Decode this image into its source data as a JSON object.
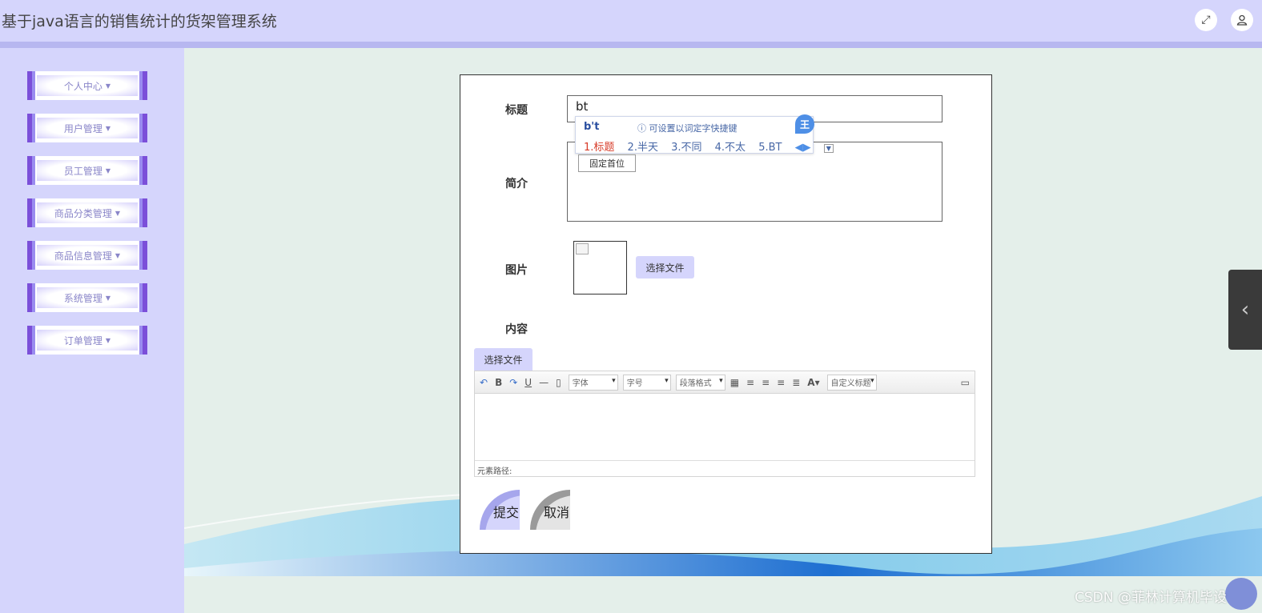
{
  "header": {
    "title": "基于java语言的销售统计的货架管理系统",
    "fullscreen_icon": "expand-icon",
    "user_icon": "user-icon"
  },
  "sidebar": {
    "items": [
      {
        "label": "个人中心"
      },
      {
        "label": "用户管理"
      },
      {
        "label": "员工管理"
      },
      {
        "label": "商品分类管理"
      },
      {
        "label": "商品信息管理"
      },
      {
        "label": "系统管理"
      },
      {
        "label": "订单管理"
      }
    ]
  },
  "form": {
    "title_label": "标题",
    "title_value": "bt",
    "intro_label": "简介",
    "image_label": "图片",
    "image_button": "选择文件",
    "content_label": "内容",
    "content_file_button": "选择文件",
    "submit": "提交",
    "cancel": "取消"
  },
  "ime": {
    "code": "b't",
    "tip": "ⓘ 可设置以词定字快捷键",
    "candidates": [
      "1.标题",
      "2.半天",
      "3.不同",
      "4.不太",
      "5.BT"
    ],
    "logo": "王",
    "pin_button": "固定首位"
  },
  "editor": {
    "font_select": "字体",
    "size_select": "字号",
    "paragraph_select": "段落格式",
    "custom_title_select": "自定义标题",
    "status_path": "元素路径:"
  },
  "watermark": "CSDN @菲林计算机毕设",
  "colors": {
    "header_bg": "#d5d5fc",
    "nav_accent": "#7b4fd9",
    "page_bg": "#e4efea"
  }
}
